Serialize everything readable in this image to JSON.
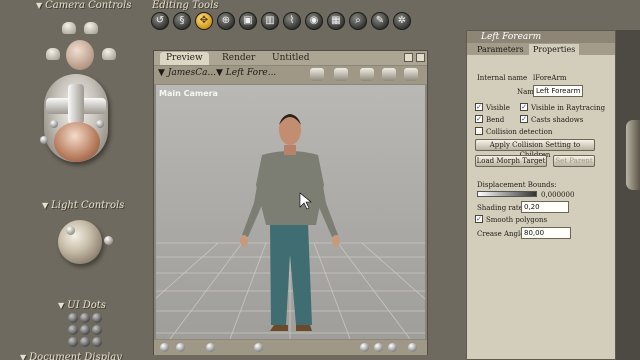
{
  "left_panel": {
    "camera_controls_title": "Camera Controls",
    "light_controls_title": "Light Controls",
    "ui_dots_title": "UI Dots",
    "bottom_title_partial": "Document Display Style"
  },
  "editing": {
    "title": "Editing Tools",
    "tools": [
      "rotate-icon",
      "twist-icon",
      "translate-icon",
      "translate-in-out-icon",
      "scale-icon",
      "taper-icon",
      "chain-break-icon",
      "color-icon",
      "grouping-icon",
      "view-magnify-icon",
      "morph-brush-icon",
      "direct-manipulation-icon"
    ]
  },
  "viewport": {
    "tabs": [
      "Preview",
      "Render"
    ],
    "doc_title": "Untitled",
    "figure_menu": "JamesCa...",
    "part_menu": "Left Fore...",
    "camera_label": "Main Camera"
  },
  "properties": {
    "header": "Left Forearm",
    "tabs": [
      "Parameters",
      "Properties"
    ],
    "internal_name_label": "Internal name",
    "internal_name_value": "lForeArm",
    "name_label": "Name",
    "name_value": "Left Forearm",
    "checks": {
      "visible": "Visible",
      "visible_raytracing": "Visible in Raytracing",
      "bend": "Bend",
      "casts_shadows": "Casts shadows",
      "collision_detection": "Collision detection"
    },
    "apply_collision_button": "Apply Collision Setting to Children",
    "load_morph_button": "Load Morph Target",
    "set_parent_button": "Set Parent",
    "displacement_label": "Displacement Bounds:",
    "displacement_value": "0,000000",
    "shading_label": "Shading rate:",
    "shading_value": "0,20",
    "smooth_polygons": "Smooth polygons",
    "crease_label": "Crease Angle",
    "crease_value": "80,00"
  },
  "colors": {
    "background": "#6f6a5f",
    "panel": "#d3cdbb",
    "active_tool": "#d29714"
  }
}
